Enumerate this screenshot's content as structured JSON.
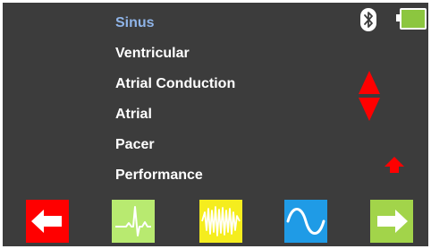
{
  "menu": {
    "items": [
      {
        "label": "Sinus",
        "selected": true
      },
      {
        "label": "Ventricular",
        "selected": false
      },
      {
        "label": "Atrial Conduction",
        "selected": false
      },
      {
        "label": "Atrial",
        "selected": false
      },
      {
        "label": "Pacer",
        "selected": false
      },
      {
        "label": "Performance",
        "selected": false
      }
    ]
  },
  "status": {
    "bluetooth_icon": "bluetooth-icon",
    "battery_icon": "battery-full-icon",
    "battery_color": "#8cc63f"
  },
  "nav": {
    "scroll_icon": "up-down-arrows-icon",
    "arrow_color": "#ff0000"
  },
  "softkeys": [
    {
      "icon": "back-arrow-icon",
      "color": "#ff0000"
    },
    {
      "icon": "ecg-waveform-icon",
      "color": "#b8ea70"
    },
    {
      "icon": "noise-waveform-icon",
      "color": "#f5ed1e"
    },
    {
      "icon": "sine-wave-icon",
      "color": "#1f9be6"
    },
    {
      "icon": "forward-arrow-icon",
      "color": "#a2d44a"
    }
  ],
  "colors": {
    "background": "#3c3c3c",
    "text": "#ffffff",
    "selected_text": "#8fb4e8"
  }
}
